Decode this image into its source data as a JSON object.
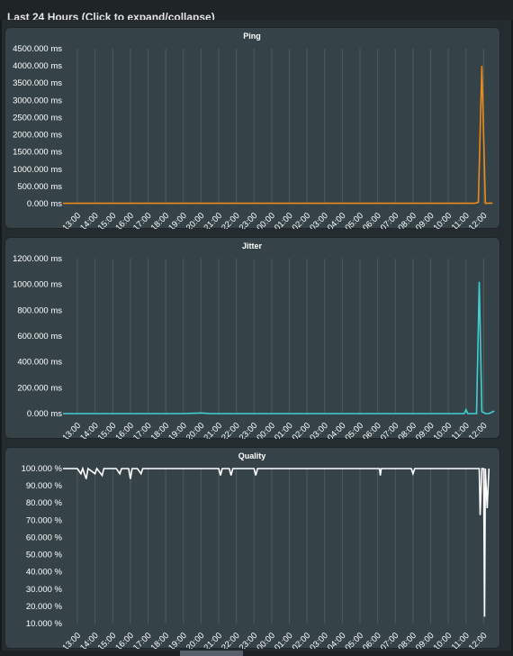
{
  "header": {
    "cut_title": "Last 24 Hours (Click to expand/collapse)"
  },
  "colors": {
    "ping": "#ee8a1a",
    "jitter": "#3fd0d4",
    "quality": "#ffffff"
  },
  "chart_data": [
    {
      "type": "line",
      "title": "Ping",
      "x": [
        "13:00",
        "14:00",
        "15:00",
        "16:00",
        "17:00",
        "18:00",
        "19:00",
        "20:00",
        "21:00",
        "22:00",
        "23:00",
        "00:00",
        "01:00",
        "02:00",
        "03:00",
        "04:00",
        "05:00",
        "06:00",
        "07:00",
        "08:00",
        "09:00",
        "10:00",
        "11:00",
        "12:00"
      ],
      "ylim": [
        0,
        4500
      ],
      "yticks": [
        "4500.000 ms",
        "4000.000 ms",
        "3500.000 ms",
        "3000.000 ms",
        "2500.000 ms",
        "2000.000 ms",
        "1500.000 ms",
        "1000.000 ms",
        "500.000 ms",
        "0.000 ms"
      ],
      "grid": true,
      "series": [
        {
          "values": [
            10,
            10,
            10,
            10,
            10,
            10,
            10,
            10,
            10,
            10,
            10,
            10,
            10,
            10,
            10,
            10,
            10,
            10,
            10,
            10,
            10,
            10,
            10,
            10,
            40,
            4000,
            10,
            15
          ]
        }
      ],
      "series_x": [
        0,
        1,
        2,
        3,
        4,
        5,
        6,
        7,
        8,
        9,
        10,
        11,
        12,
        13,
        14,
        15,
        16,
        17,
        18,
        19,
        20,
        21,
        22,
        22.5,
        22.7,
        22.9,
        23.1,
        23.5
      ]
    },
    {
      "type": "line",
      "title": "Jitter",
      "x": [
        "13:00",
        "14:00",
        "15:00",
        "16:00",
        "17:00",
        "18:00",
        "19:00",
        "20:00",
        "21:00",
        "22:00",
        "23:00",
        "00:00",
        "01:00",
        "02:00",
        "03:00",
        "04:00",
        "05:00",
        "06:00",
        "07:00",
        "08:00",
        "09:00",
        "10:00",
        "11:00",
        "12:00"
      ],
      "ylim": [
        0,
        1200
      ],
      "yticks": [
        "1200.000 ms",
        "1000.000 ms",
        "800.000 ms",
        "600.000 ms",
        "400.000 ms",
        "200.000 ms",
        "0.000 ms"
      ],
      "grid": true,
      "series": [
        {
          "values": [
            0,
            0,
            0,
            0,
            0,
            0,
            0,
            5,
            0,
            0,
            0,
            0,
            0,
            0,
            0,
            0,
            0,
            0,
            0,
            0,
            0,
            0,
            0,
            0,
            30,
            0,
            0,
            1020,
            15,
            0,
            0,
            20
          ]
        }
      ],
      "series_x": [
        0,
        1,
        2,
        3,
        4,
        5,
        6,
        7,
        7.5,
        8,
        9,
        10,
        11,
        12,
        13,
        14,
        15,
        16,
        17,
        18,
        19,
        20,
        21,
        21.9,
        22.0,
        22.1,
        22.6,
        22.75,
        22.9,
        23.1,
        23.3,
        23.6
      ]
    },
    {
      "type": "line",
      "title": "Quality",
      "x": [
        "13:00",
        "14:00",
        "15:00",
        "16:00",
        "17:00",
        "18:00",
        "19:00",
        "20:00",
        "21:00",
        "22:00",
        "23:00",
        "00:00",
        "01:00",
        "02:00",
        "03:00",
        "04:00",
        "05:00",
        "06:00",
        "07:00",
        "08:00",
        "09:00",
        "10:00",
        "11:00",
        "12:00"
      ],
      "ylim": [
        10,
        100
      ],
      "yticks": [
        "100.000 %",
        "90.000 %",
        "80.000 %",
        "70.000 %",
        "60.000 %",
        "50.000 %",
        "40.000 %",
        "30.000 %",
        "20.000 %",
        "10.000 %"
      ],
      "grid": true,
      "series": [
        {
          "values": [
            100,
            100,
            97,
            100,
            94,
            100,
            97,
            100,
            96,
            100,
            100,
            97,
            100,
            100,
            94,
            100,
            100,
            97,
            100,
            100,
            100,
            100,
            100,
            100,
            100,
            96,
            100,
            100,
            96,
            100,
            100,
            96,
            100,
            100,
            100,
            100,
            100,
            100,
            100,
            100,
            100,
            100,
            100,
            96,
            100,
            100,
            100,
            97,
            100,
            100,
            100,
            100,
            100,
            100,
            100,
            73,
            100,
            100,
            14,
            100,
            77,
            100
          ]
        }
      ],
      "series_x": [
        -0.5,
        0,
        0.2,
        0.3,
        0.5,
        0.6,
        1.0,
        1.1,
        1.4,
        1.5,
        2.2,
        2.4,
        2.5,
        2.9,
        3.0,
        3.1,
        3.4,
        3.6,
        3.7,
        4,
        5,
        6,
        7,
        7.8,
        8,
        8.1,
        8.2,
        8.6,
        8.7,
        8.8,
        10.0,
        10.1,
        10.2,
        11,
        12,
        13,
        14,
        15,
        16,
        16.6,
        16.9,
        17.0,
        17.1,
        17.15,
        17.2,
        18.8,
        18.9,
        19.0,
        19.1,
        20,
        21,
        22,
        22.6,
        22.7,
        22.75,
        22.8,
        22.9,
        23.0,
        23.05,
        23.1,
        23.2,
        23.3
      ]
    }
  ]
}
